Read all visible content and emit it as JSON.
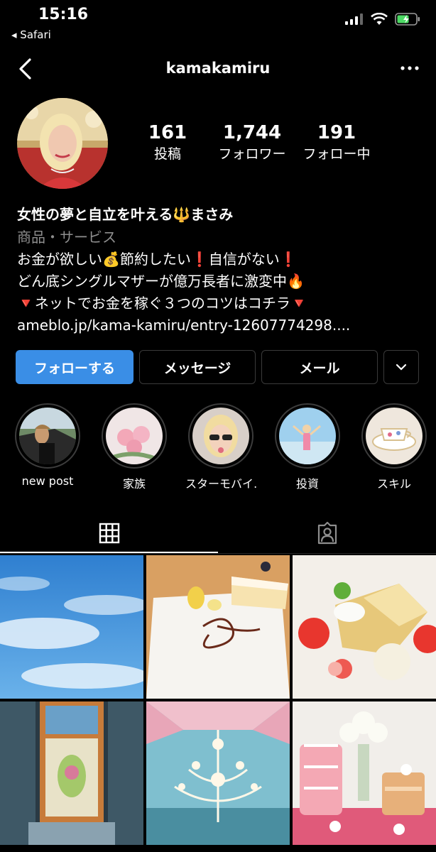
{
  "status_bar": {
    "time": "15:16",
    "back_app": "◂ Safari",
    "battery_color": "#4cd964"
  },
  "nav": {
    "username": "kamakamiru",
    "back_icon": "chevron-left-icon",
    "more_icon": "ellipsis-icon"
  },
  "profile": {
    "stats": [
      {
        "value": "161",
        "label": "投稿"
      },
      {
        "value": "1,744",
        "label": "フォロワー"
      },
      {
        "value": "191",
        "label": "フォロー中"
      }
    ],
    "name": "女性の夢と自立を叶える🔱まさみ",
    "category": "商品・サービス",
    "bio_lines": [
      "お金が欲しい💰節約したい❗自信がない❗",
      "どん底シングルマザーが億万長者に激変中🔥",
      "🔻ネットでお金を稼ぐ３つのコツはコチラ🔻"
    ],
    "link": "ameblo.jp/kama-kamiru/entry-12607774298...."
  },
  "actions": {
    "follow": "フォローする",
    "message": "メッセージ",
    "mail": "メール",
    "more_icon": "chevron-down-icon",
    "follow_color": "#3a8ee6"
  },
  "highlights": [
    {
      "label": "new post"
    },
    {
      "label": "家族"
    },
    {
      "label": "スターモバイ…"
    },
    {
      "label": "投資"
    },
    {
      "label": "スキル"
    }
  ],
  "tabs": {
    "grid_icon": "grid-icon",
    "tagged_icon": "tagged-person-icon",
    "active": "grid"
  }
}
